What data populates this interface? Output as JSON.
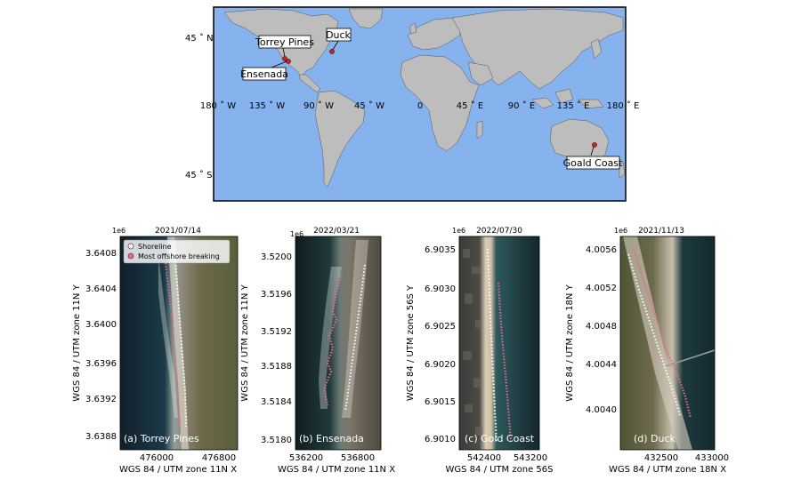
{
  "world_map": {
    "lat_labels": [
      "45 ˚ N",
      "45 ˚ S"
    ],
    "lon_labels": [
      "180 ˚ W",
      "135 ˚ W",
      "90 ˚ W",
      "45 ˚ W",
      "0",
      "45 ˚ E",
      "90 ˚ E",
      "135 ˚ E",
      "180 ˚ E"
    ],
    "sites": [
      {
        "label": "Torrey Pines"
      },
      {
        "label": "Duck"
      },
      {
        "label": "Ensenada"
      },
      {
        "label": "Goald Coast"
      }
    ],
    "colors": {
      "ocean": "#86b3ee",
      "land": "#bdbdbd",
      "marker": "#d81e1e"
    }
  },
  "legend": {
    "shoreline": "Shoreline",
    "breaking": "Most offshore breaking"
  },
  "panels": [
    {
      "date": "2021/07/14",
      "label": "(a) Torrey Pines",
      "exponent": "1e6",
      "ylabel": "WGS 84 / UTM zone 11N Y",
      "xlabel": "WGS 84 / UTM zone 11N X",
      "yticks": [
        "3.6408",
        "3.6404",
        "3.6400",
        "3.6396",
        "3.6392",
        "3.6388"
      ],
      "xticks": [
        "476000",
        "476800"
      ]
    },
    {
      "date": "2022/03/21",
      "label": "(b) Ensenada",
      "exponent": "1e6",
      "ylabel": "WGS 84 / UTM zone 11N Y",
      "xlabel": "WGS 84 / UTM zone 11N X",
      "yticks": [
        "3.5200",
        "3.5196",
        "3.5192",
        "3.5188",
        "3.5184",
        "3.5180"
      ],
      "xticks": [
        "536200",
        "536800"
      ]
    },
    {
      "date": "2022/07/30",
      "label": "(c) Gold Coast",
      "exponent": "1e6",
      "ylabel": "WGS 84 / UTM zone 56S Y",
      "xlabel": "WGS 84 / UTM zone 56S",
      "yticks": [
        "6.9035",
        "6.9030",
        "6.9025",
        "6.9020",
        "6.9015",
        "6.9010"
      ],
      "xticks": [
        "542400",
        "543200"
      ]
    },
    {
      "date": "2021/11/13",
      "label": "(d) Duck",
      "exponent": "1e6",
      "ylabel": "WGS 84 / UTM zone 18N Y",
      "xlabel": "WGS 84 / UTM zone 18N X",
      "yticks": [
        "4.0056",
        "4.0052",
        "4.0048",
        "4.0044",
        "4.0040"
      ],
      "xticks": [
        "432500",
        "433000"
      ]
    }
  ]
}
